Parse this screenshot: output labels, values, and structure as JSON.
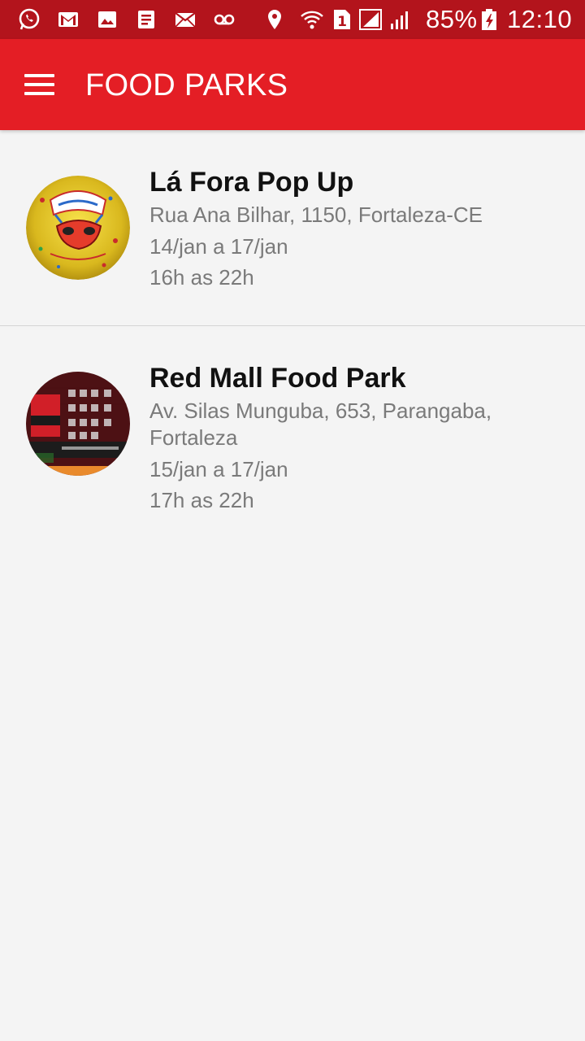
{
  "status_bar": {
    "battery_percent": "85%",
    "time": "12:10",
    "sim_indicator": "1",
    "icons": [
      "whatsapp-icon",
      "gmail-icon",
      "gallery-icon",
      "notes-icon",
      "mail-icon",
      "voicemail-icon",
      "location-icon",
      "wifi-icon",
      "sim-icon",
      "signal-icon",
      "signal-icon",
      "battery-charging-icon"
    ]
  },
  "app_bar": {
    "title": "FOOD PARKS",
    "menu_icon": "menu-icon"
  },
  "colors": {
    "status_bar": "#b3141c",
    "app_bar": "#e41e25",
    "background": "#f4f4f4",
    "title_text": "#111111",
    "secondary_text": "#7a7a7a"
  },
  "parks": [
    {
      "name": "Lá Fora Pop Up",
      "address": "Rua Ana Bilhar, 1150, Fortaleza-CE",
      "dates": "14/jan a 17/jan",
      "hours": "16h as 22h"
    },
    {
      "name": "Red Mall Food Park",
      "address": "Av. Silas Munguba, 653, Parangaba, Fortaleza",
      "dates": "15/jan a 17/jan",
      "hours": "17h as 22h"
    }
  ]
}
